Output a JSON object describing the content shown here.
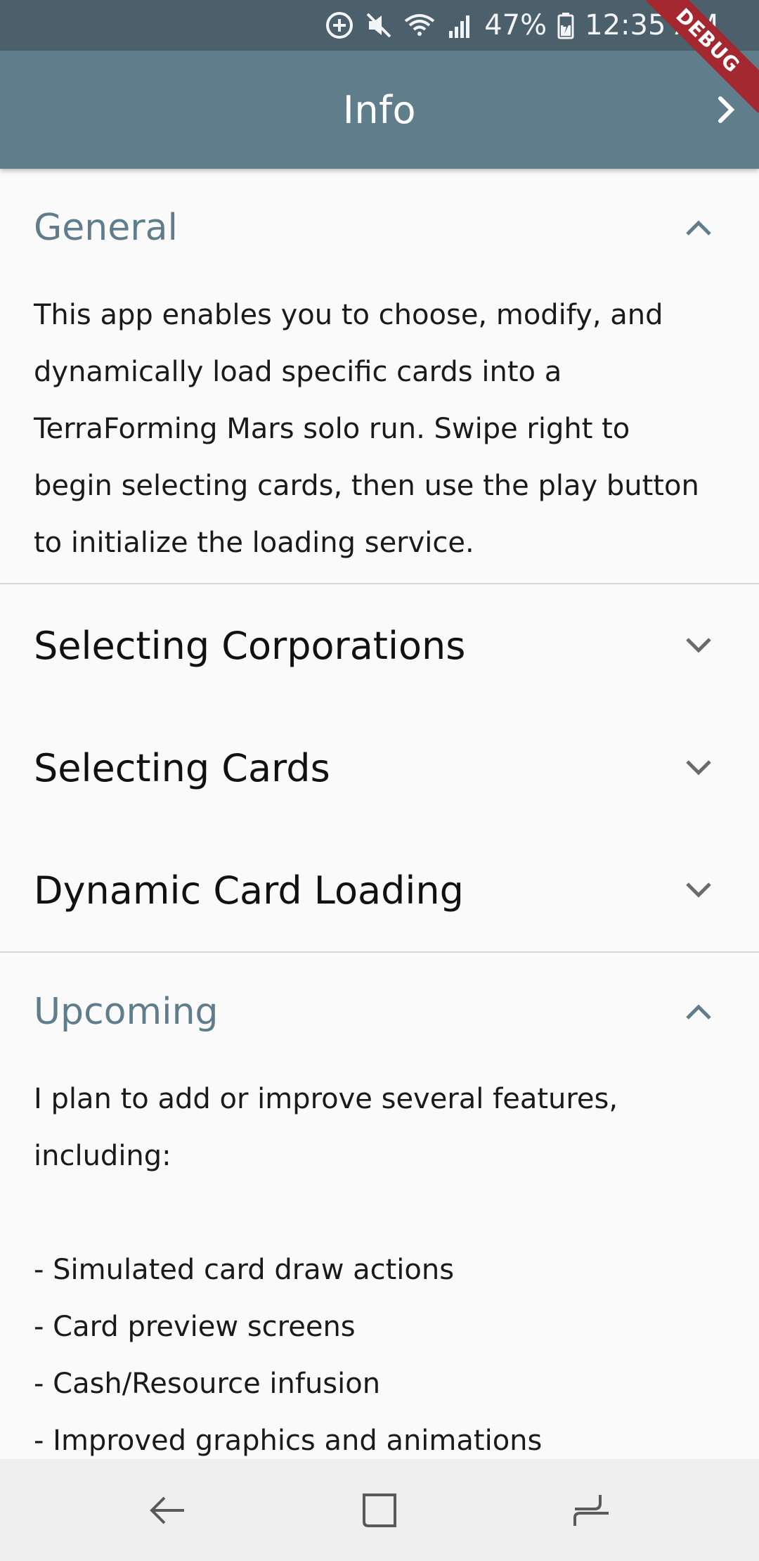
{
  "status_bar": {
    "battery": "47%",
    "time": "12:35 AM",
    "icons": [
      "data-saver-icon",
      "mute-icon",
      "wifi-icon",
      "signal-icon",
      "battery-icon"
    ]
  },
  "debug_banner": "DEBUG",
  "app_bar": {
    "title": "Info",
    "next_icon": "chevron-right-icon"
  },
  "colors": {
    "status_bar": "#4c606c",
    "app_bar": "#607d8b",
    "accent": "#607d8b",
    "background": "#fafafa",
    "nav_bar": "#efefef"
  },
  "panels": [
    {
      "title": "General",
      "expanded": true,
      "body_lines": [
        "This app enables you to choose, modify, and",
        "dynamically load specific cards into a",
        "TerraForming Mars solo run. Swipe right to",
        "begin selecting cards, then use the play button",
        "to initialize the loading service."
      ]
    },
    {
      "title": "Selecting Corporations",
      "expanded": false
    },
    {
      "title": "Selecting Cards",
      "expanded": false
    },
    {
      "title": "Dynamic Card Loading",
      "expanded": false
    },
    {
      "title": "Upcoming",
      "expanded": true,
      "body_lines": [
        "I plan to add or improve several features,",
        "including:",
        "",
        "- Simulated card draw actions",
        "- Card preview screens",
        "- Cash/Resource infusion",
        "- Improved graphics and animations"
      ]
    }
  ],
  "nav_bar": {
    "buttons": [
      "back-icon",
      "home-icon",
      "recents-icon"
    ]
  }
}
